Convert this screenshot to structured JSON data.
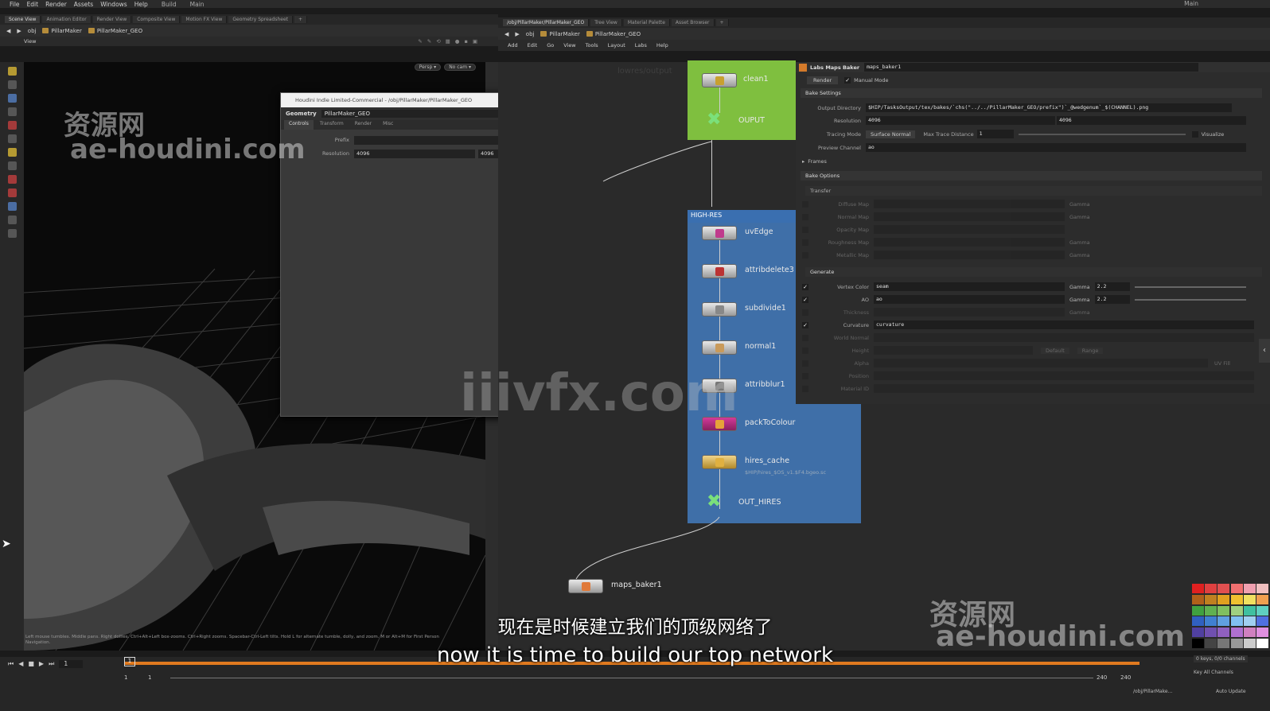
{
  "menubar": {
    "items": [
      "File",
      "Edit",
      "Render",
      "Assets",
      "Windows",
      "Help"
    ],
    "desktop": "Build",
    "main_label": "Main",
    "right_label": "Main"
  },
  "left_tabs": [
    "Scene View",
    "Animation Editor",
    "Render View",
    "Composite View",
    "Motion FX View",
    "Geometry Spreadsheet"
  ],
  "right_tabs": [
    "/obj/PillarMaker/PillarMaker_GEO",
    "Tree View",
    "Material Palette",
    "Asset Browser"
  ],
  "left_path": {
    "root": "obj",
    "node1": "PillarMaker",
    "node2": "PillarMaker_GEO"
  },
  "right_path": {
    "root": "obj",
    "node1": "PillarMaker",
    "node2": "PillarMaker_GEO"
  },
  "view_label": "View",
  "viewport_buttons": {
    "persp": "Persp ▾",
    "cam": "No cam ▾"
  },
  "viewport_hint": "Left mouse tumbles. Middle pans. Right dollies. Ctrl+Alt+Left box-zooms. Ctrl+Right zooms. Spacebar-Ctrl-Left tilts. Hold L for alternate tumble, dolly, and zoom.    M or Alt+M for First Person Navigation.",
  "net_menu": [
    "Add",
    "Edit",
    "Go",
    "View",
    "Tools",
    "Layout",
    "Labs",
    "Help"
  ],
  "geo_window": {
    "title": "Houdini Indie Limited-Commercial - /obj/PillarMaker/PillarMaker_GEO",
    "type_label": "Geometry",
    "node_name": "PillarMaker_GEO",
    "tabs": [
      "Controls",
      "Transform",
      "Render",
      "Misc"
    ],
    "prefix_label": "Prefix",
    "prefix_value": "",
    "resolution_label": "Resolution",
    "resolution_x": "4096",
    "resolution_y": "4096"
  },
  "network": {
    "ghost_label": "lowres/output",
    "nodes_top": [
      {
        "label": "clean1"
      },
      {
        "label": "OUPUT"
      }
    ],
    "hires_box_title": "HIGH-RES",
    "nodes_hires": [
      {
        "label": "uvEdge"
      },
      {
        "label": "attribdelete3"
      },
      {
        "label": "subdivide1"
      },
      {
        "label": "normal1"
      },
      {
        "label": "attribblur1"
      },
      {
        "label": "packToColour"
      },
      {
        "label": "hires_cache"
      },
      {
        "label": "OUT_HIRES"
      }
    ],
    "hires_cache_file": "$HIP/hires_$OS_v1.$F4.bgeo.sc",
    "baker_label": "maps_baker1"
  },
  "params": {
    "node_type": "Labs Maps Baker",
    "node_name": "maps_baker1",
    "render_btn": "Render",
    "manual_mode": "Manual Mode",
    "bake_settings": "Bake Settings",
    "output_dir_label": "Output Directory",
    "output_dir": "$HIP/TasksOutput/tex/bakes/`chs(\"../../PillarMaker_GEO/prefix\")`_@wedgenum`_$(CHANNEL).png",
    "resolution_label": "Resolution",
    "res_x": "4096",
    "res_y": "4096",
    "tracing_label": "Tracing Mode",
    "tracing_value": "Surface Normal",
    "max_trace_label": "Max Trace Distance",
    "max_trace_value": "1",
    "visualize": "Visualize",
    "preview_label": "Preview Channel",
    "preview_value": "ao",
    "frames": "Frames",
    "bake_options": "Bake Options",
    "transfer": "Transfer",
    "transfer_rows": [
      "Diffuse Map",
      "Normal Map",
      "Opacity Map",
      "Roughness Map",
      "Metallic Map"
    ],
    "gamma": "Gamma",
    "generate": "Generate",
    "vertex_color_label": "Vertex Color",
    "vertex_color_value": "seam",
    "vc_gamma": "2.2",
    "ao_label": "AO",
    "ao_value": "ao",
    "ao_gamma": "2.2",
    "thickness_label": "Thickness",
    "curvature_label": "Curvature",
    "curvature_value": "curvature",
    "rows_dim": [
      "World Normal",
      "Height",
      "Alpha",
      "Position",
      "Material ID"
    ],
    "default_btn": "Default",
    "range_btn": "Range",
    "uv_tile": "UV Fill"
  },
  "timeline": {
    "frame": "1",
    "start": "1",
    "start2": "1",
    "end": "240",
    "end2": "240",
    "keys_info": "0 keys, 0/0 channels",
    "key_all": "Key All Channels",
    "auto_update": "Auto Update",
    "path": "/obj/PillarMake..."
  },
  "subtitle_cn": "现在是时候建立我们的顶级网络了",
  "subtitle_en": "now it is time to build our top network",
  "watermarks": {
    "cn": "资源网",
    "site": "ae-houdini.com",
    "center": "iiivfx.com"
  },
  "colors": {
    "network_green": "#7fbf3f",
    "network_blue": "#3f6fa8",
    "timeline_orange": "#e07a1f"
  }
}
